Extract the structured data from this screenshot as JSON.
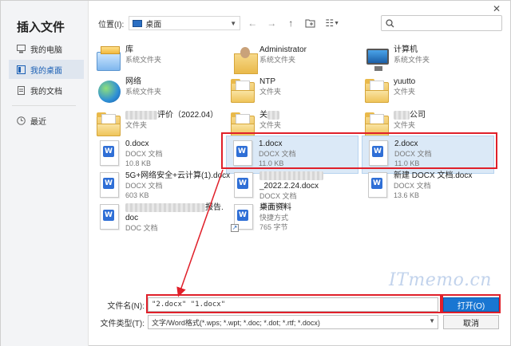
{
  "dialog": {
    "title": "插入文件",
    "close": "✕"
  },
  "sidebar": {
    "items": [
      {
        "label": "我的电脑",
        "icon": "computer-icon"
      },
      {
        "label": "我的桌面",
        "icon": "desktop-icon",
        "active": true
      },
      {
        "label": "我的文档",
        "icon": "document-icon"
      },
      {
        "label": "最近",
        "icon": "clock-icon"
      }
    ]
  },
  "toolbar": {
    "location_label": "位置(I):",
    "location_value": "桌面",
    "back": "←",
    "forward": "→",
    "up": "↑",
    "new_folder": "⊞",
    "view": "☷",
    "search_placeholder": ""
  },
  "files": [
    {
      "name": "库",
      "sub": "系统文件夹",
      "icon": "library-icon"
    },
    {
      "name": "Administrator",
      "sub": "系统文件夹",
      "icon": "user-folder-icon"
    },
    {
      "name": "计算机",
      "sub": "系统文件夹",
      "icon": "computer-icon"
    },
    {
      "name": "网络",
      "sub": "系统文件夹",
      "icon": "network-icon"
    },
    {
      "name": "NTP",
      "sub": "文件夹",
      "icon": "folder-icon"
    },
    {
      "name": "yuutto",
      "sub": "文件夹",
      "icon": "folder-icon"
    },
    {
      "name": "评价（2022.04）",
      "sub": "文件夹",
      "icon": "folder-icon",
      "blurred_prefix": true
    },
    {
      "name": "关",
      "sub": "文件夹",
      "icon": "folder-icon",
      "blurred_prefix": true
    },
    {
      "name": "公司",
      "sub": "文件夹",
      "icon": "folder-icon",
      "blurred_prefix": true
    },
    {
      "name": "0.docx",
      "sub": "DOCX 文档",
      "size": "10.8 KB",
      "icon": "word-doc-icon"
    },
    {
      "name": "1.docx",
      "sub": "DOCX 文档",
      "size": "11.0 KB",
      "icon": "word-doc-icon",
      "selected": true
    },
    {
      "name": "2.docx",
      "sub": "DOCX 文档",
      "size": "11.0 KB",
      "icon": "word-doc-icon",
      "selected": true
    },
    {
      "name": "5G+网络安全+云计算(1).docx",
      "sub": "DOCX 文档",
      "size": "603 KB",
      "icon": "word-doc-icon"
    },
    {
      "name": "_2022.2.24.docx",
      "sub": "DOCX 文档",
      "size": "16.2 KB",
      "icon": "word-doc-icon"
    },
    {
      "name": "新建 DOCX 文档.docx",
      "sub": "DOCX 文档",
      "size": "13.6 KB",
      "icon": "word-doc-icon"
    },
    {
      "name": "报告.",
      "name2": "doc",
      "sub": "DOC 文档",
      "icon": "word-doc-icon"
    },
    {
      "name": "桌面资料",
      "sub": "快捷方式",
      "size": "765 字节",
      "icon": "shortcut-icon"
    }
  ],
  "form": {
    "filename_label": "文件名(N):",
    "filename_value": "\"2.docx\" \"1.docx\"",
    "filetype_label": "文件类型(T):",
    "filetype_value": "文字/Word格式(*.wps; *.wpt; *.doc; *.dot; *.rtf; *.docx)",
    "open_label": "打开(O)",
    "cancel_label": "取消"
  },
  "watermark": "ITmemo.cn",
  "colors": {
    "accent": "#1976d2",
    "highlight": "#e0202a",
    "selected_bg": "#dbe9f7"
  }
}
